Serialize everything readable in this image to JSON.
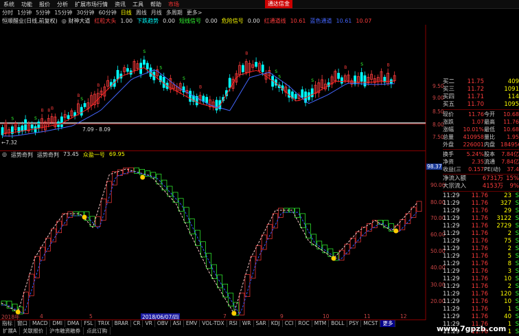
{
  "menu": {
    "items": [
      "系统",
      "功能",
      "报价",
      "分析",
      "扩展市场行情",
      "资讯",
      "工具",
      "帮助"
    ],
    "market": "市场",
    "brand": "通达信金"
  },
  "periods": {
    "items": [
      "分时",
      "1分钟",
      "5分钟",
      "15分钟",
      "30分钟",
      "60分钟",
      "日线",
      "周线",
      "月线",
      "多周期",
      "更多>"
    ],
    "selected_index": 6
  },
  "info": {
    "stock": "恒顺醋业(日线,前复权)",
    "indicator": "◎ 财神大道",
    "f1": "红粒大头",
    "f1v": "1.00",
    "f2": "下跌趋势",
    "f2v": "0.00",
    "f3": "短线信号",
    "f3v": "0.00",
    "f4": "危险信号",
    "f4v": "0.00",
    "f5": "红通道线",
    "f5v": "10.61",
    "f6": "蓝色通道",
    "f6v": "10.61",
    "f7": "10.07"
  },
  "price_axis": {
    "labels": [
      "9.50",
      "9.00",
      "8.50",
      "8.00",
      "7.50"
    ],
    "low_marker": "←7.32",
    "mid_marker": "7.09 - 8.09"
  },
  "indicator_label": {
    "icon": "◎",
    "name": "运势奇判",
    "name2": "运势奇判",
    "v1": "73.45",
    "name3": "众盈一号",
    "v2": "69.95"
  },
  "ind_axis": {
    "current": "98.37",
    "labels": [
      "90.00",
      "80.00",
      "70.00",
      "60.00",
      "50.00",
      "40.00",
      "30.00",
      "20.00"
    ]
  },
  "date_axis": {
    "start": "2018年",
    "labels": [
      "4",
      "5",
      "6",
      "7",
      "8",
      "9",
      "10",
      "11",
      "12"
    ],
    "highlight": "2018/06/07/四"
  },
  "tabs": {
    "items": [
      "指标",
      "窗口",
      "MACD",
      "DMI",
      "DMA",
      "FSL",
      "TRIX",
      "BRAR",
      "CR",
      "VR",
      "OBV",
      "ASI",
      "EMV",
      "VOL-TDX",
      "RSI",
      "WR",
      "SAR",
      "KDJ",
      "CCI",
      "ROC",
      "MTM",
      "BOLL",
      "PSY",
      "MCST",
      "更多"
    ],
    "selected": "更多"
  },
  "bottom": {
    "items": [
      "扩展A",
      "关联报价",
      "沪市融资融券",
      "点此订购"
    ]
  },
  "quote": {
    "buy2": {
      "label": "买二",
      "price": "11.75",
      "vol": "409"
    },
    "buy3": {
      "label": "买三",
      "price": "11.72",
      "vol": "1091"
    },
    "buy4": {
      "label": "买四",
      "price": "11.71",
      "vol": "114"
    },
    "buy5": {
      "label": "买五",
      "price": "11.70",
      "vol": "1095"
    },
    "rows": [
      {
        "l1": "现价",
        "v1": "11.76",
        "l2": "今开",
        "v2": "10.68"
      },
      {
        "l1": "涨跌",
        "v1": "1.07",
        "l2": "最高",
        "v2": "11.76"
      },
      {
        "l1": "涨幅",
        "v1": "10.01%",
        "l2": "最低",
        "v2": "10.68"
      },
      {
        "l1": "总量",
        "v1": "410958",
        "l2": "量比",
        "v2": "1.95"
      },
      {
        "l1": "外盘",
        "v1": "226001",
        "l2": "内盘",
        "v2": "184956"
      }
    ],
    "rows2": [
      {
        "l1": "换手",
        "v1": "5.24%",
        "l2": "股本",
        "v2": "7.84亿"
      },
      {
        "l1": "净资",
        "v1": "2.35",
        "l2": "流通",
        "v2": "7.84亿"
      },
      {
        "l1": "收益(三)",
        "v1": "0.157",
        "l2": "PE(动)",
        "v2": "37.4"
      }
    ],
    "flow": [
      {
        "label": "净流入额",
        "value": "6731万",
        "pct": "15%"
      },
      {
        "label": "大宗流入",
        "value": "4153万",
        "pct": "9%"
      }
    ]
  },
  "ticks": [
    {
      "t": "11:29",
      "p": "11.76",
      "v": "23",
      "s": "S"
    },
    {
      "t": "11:29",
      "p": "11.76",
      "v": "327",
      "s": "S"
    },
    {
      "t": "11:29",
      "p": "11.76",
      "v": "29",
      "s": "S"
    },
    {
      "t": "11:29",
      "p": "11.76",
      "v": "3122",
      "s": "S"
    },
    {
      "t": "11:29",
      "p": "11.76",
      "v": "2729",
      "s": "S"
    },
    {
      "t": "11:29",
      "p": "11.76",
      "v": "2",
      "s": "S"
    },
    {
      "t": "11:29",
      "p": "11.76",
      "v": "75",
      "s": "S"
    },
    {
      "t": "11:29",
      "p": "11.76",
      "v": "2",
      "s": "S"
    },
    {
      "t": "11:29",
      "p": "11.76",
      "v": "5",
      "s": "S"
    },
    {
      "t": "11:29",
      "p": "11.76",
      "v": "8",
      "s": "S"
    },
    {
      "t": "11:29",
      "p": "11.76",
      "v": "3",
      "s": "S"
    },
    {
      "t": "11:29",
      "p": "11.76",
      "v": "10",
      "s": "S"
    },
    {
      "t": "11:29",
      "p": "11.76",
      "v": "2",
      "s": "S"
    },
    {
      "t": "11:29",
      "p": "11.76",
      "v": "120",
      "s": "S"
    },
    {
      "t": "11:29",
      "p": "11.76",
      "v": "10",
      "s": "S"
    },
    {
      "t": "11:29",
      "p": "11.76",
      "v": "1",
      "s": "S"
    },
    {
      "t": "11:29",
      "p": "11.76",
      "v": "40",
      "s": "S"
    },
    {
      "t": "11:29",
      "p": "11.76",
      "v": "1",
      "s": "S"
    },
    {
      "t": "11:29",
      "p": "11.76",
      "v": "1",
      "s": "S"
    }
  ],
  "watermark": "www.7gpzb.com",
  "colors": {
    "up": "#ff3c3c",
    "down": "#00ffff",
    "signal": "#33ff33",
    "accent": "#ffff00"
  }
}
